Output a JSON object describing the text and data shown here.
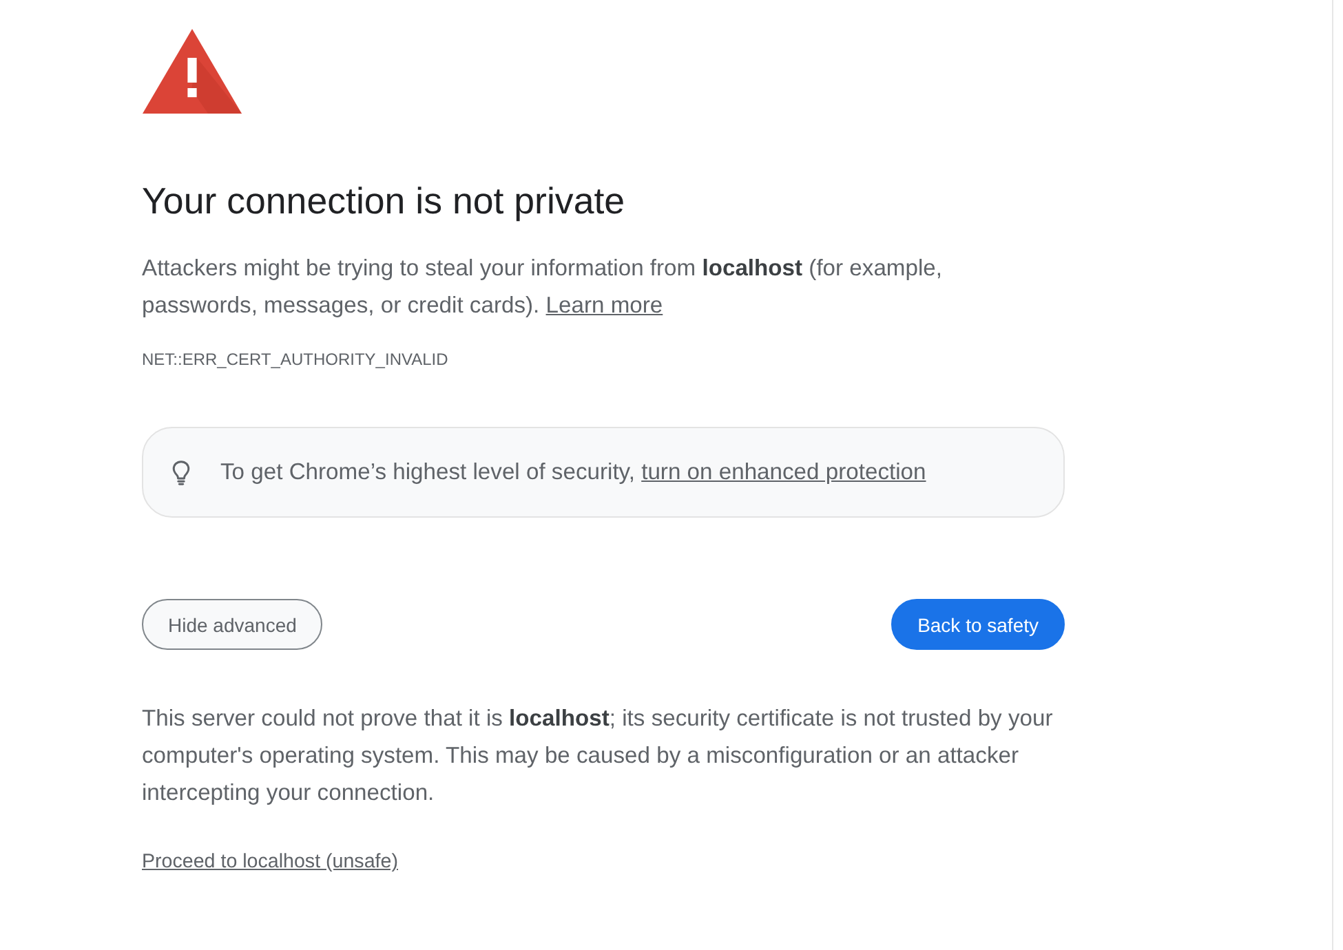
{
  "heading": "Your connection is not private",
  "message": {
    "text": "Attackers might be trying to steal your information from **localhost** (for example, passwords, messages, or credit cards).",
    "link": "Learn more"
  },
  "error_code": "NET::ERR_CERT_AUTHORITY_INVALID",
  "promo": {
    "text": "To get Chrome’s highest level of security,",
    "link": "turn on enhanced protection"
  },
  "buttons": [
    {
      "label": "Hide advanced",
      "kind": "secondary"
    },
    {
      "label": "Back to safety",
      "kind": "primary"
    }
  ],
  "details": "This server could not prove that it is **localhost**; its security certificate is not trusted by your computer's operating system. This may be caused by a misconfiguration or an attacker intercepting your connection.",
  "proceed_link": "Proceed to localhost (unsafe)"
}
